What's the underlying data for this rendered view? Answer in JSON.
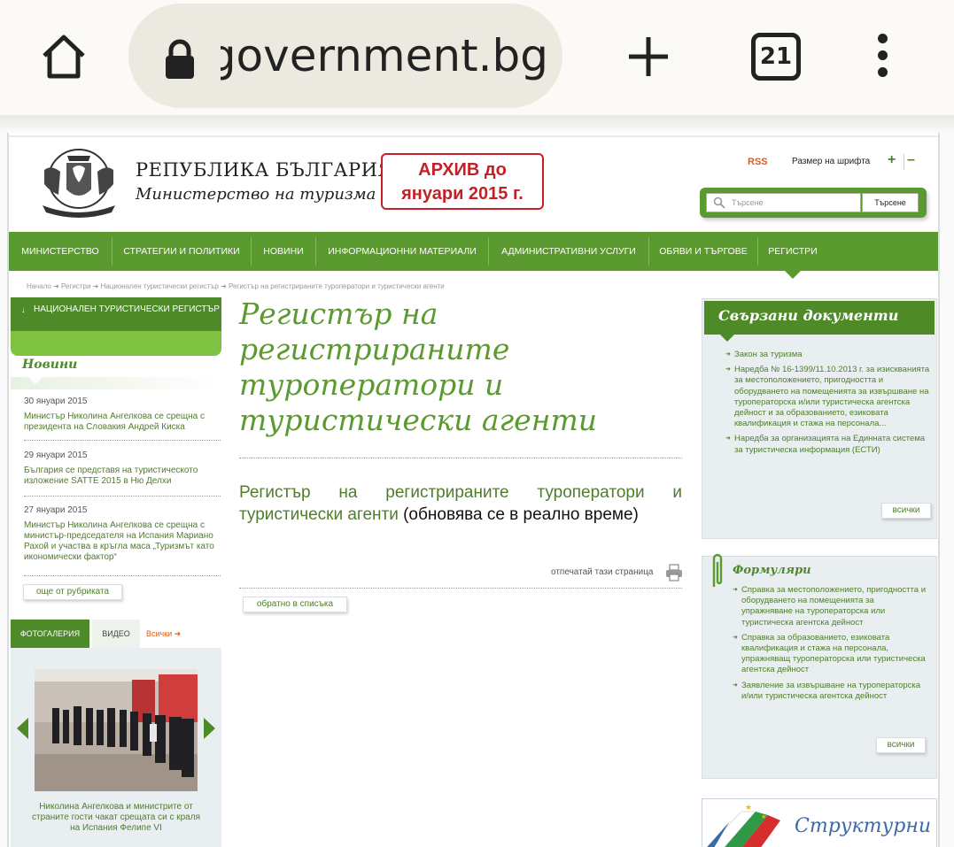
{
  "browser": {
    "url": "government.bg",
    "tab_count": "21"
  },
  "header": {
    "title": "РЕПУБЛИКА БЪЛГАРИЯ",
    "subtitle": "Министерство на туризма",
    "archive_line1": "АРХИВ до",
    "archive_line2": "януари 2015 г.",
    "rss": "RSS",
    "font_size_label": "Размер на шрифта",
    "font_plus": "+",
    "font_minus": "–",
    "search_placeholder": "Търсене",
    "search_button": "Търсене"
  },
  "nav": {
    "items": [
      "МИНИСТЕРСТВО",
      "СТРАТЕГИИ И ПОЛИТИКИ",
      "НОВИНИ",
      "ИНФОРМАЦИОННИ МАТЕРИАЛИ",
      "АДМИНИСТРАТИВНИ УСЛУГИ",
      "ОБЯВИ И ТЪРГОВЕ",
      "РЕГИСТРИ"
    ]
  },
  "breadcrumb": "Начало ➜ Регистри ➜ Национален туристически регистър ➜ Регистър на регистрираните туроператори и туристически агенти",
  "sidebar": {
    "section_title": "НАЦИОНАЛЕН ТУРИСТИЧЕСКИ РЕГИСТЪР",
    "news_heading": "Новини",
    "news": [
      {
        "date": "30 януари 2015",
        "text": "Министър Николина Ангелкова се срещна с президента на Словакия Андрей Киска"
      },
      {
        "date": "29 януари 2015",
        "text": "България се представя на туристическото изложение SATTE 2015 в Ню Делхи"
      },
      {
        "date": "27 януари 2015",
        "text": "Министър Николина Ангелкова се срещна с министър-председателя на Испания Мариано Рахой и участва в кръгла маса „Туризмът като икономически фактор“"
      }
    ],
    "more_button": "още от рубриката",
    "gallery_tab": "ФОТОГАЛЕРИЯ",
    "video_tab": "ВИДЕО",
    "all_link": "Всички ➜",
    "gallery_caption": "Николина Ангелкова и министрите от страните гости чакат срещата си с краля на Испания Фелипе VI"
  },
  "main": {
    "title": "Регистър на регистрираните туроператори и туристически агенти",
    "link_text": "Регистър на регистрираните туроператори и туристически агенти",
    "suffix_text": " (обновява се в реално време)",
    "print_label": "отпечатай тази страница",
    "back_button": "обратно в списъка"
  },
  "related": {
    "heading": "Свързани документи",
    "docs": [
      "Закон за туризма",
      "Наредба № 16-1399/11.10.2013 г. за изискванията за местоположението, пригодността и оборудването на помещенията за извършване на туроператорска и/или туристическа агентска дейност и за образованието, езиковата квалификация и стажа на персонала...",
      "Наредба за организацията на Единната система за туристическа информация (ЕСТИ)"
    ],
    "all_button": "всички"
  },
  "forms": {
    "heading": "Формуляри",
    "items": [
      "Справка за местоположението, пригодността и оборудването на помещенията за упражняване на туроператорска или туристическа агентска дейност",
      "Справка за образованието, езиковата квалификация и стажа на персонала, упражняващ туроператорска или туристическа агентска дейност",
      "Заявление за извършване на туроператорска и/или туристическа агентска дейност"
    ],
    "all_button": "всички"
  },
  "banner": {
    "text": "Структурни"
  },
  "colors": {
    "brand_green": "#5b9a2e",
    "dark_green": "#4e8b28",
    "archive_red": "#c32127",
    "rss_orange": "#e05a1b"
  }
}
